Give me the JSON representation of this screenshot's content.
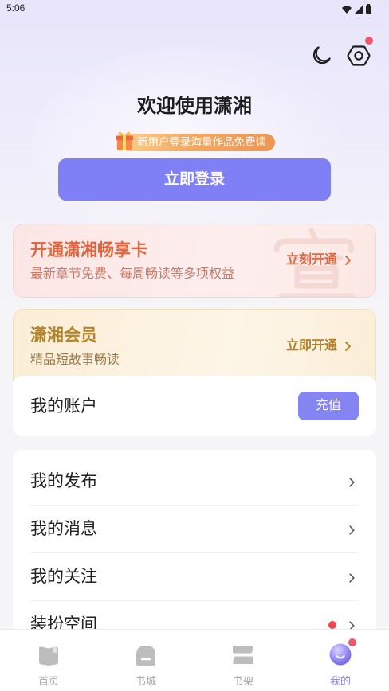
{
  "status_bar": {
    "time": "5:06",
    "icons": [
      "wifi-icon",
      "signal-icon",
      "battery-icon"
    ]
  },
  "header": {
    "night_mode_icon": "moon-icon",
    "settings_icon": "settings-icon",
    "settings_badge": true
  },
  "welcome": {
    "title": "欢迎使用潇湘",
    "promo_icon": "gift-icon",
    "promo_text": "新用户登录海量作品免费读",
    "login_button": "立即登录"
  },
  "vip_card": {
    "title": "开通潇湘畅享卡",
    "subtitle": "最新章节免费、每周畅读等多项权益",
    "action": "立刻开通"
  },
  "member_card": {
    "title": "潇湘会员",
    "subtitle": "精品短故事畅读",
    "action": "立即开通"
  },
  "account_card": {
    "label": "我的账户",
    "recharge_button": "充值"
  },
  "menu": {
    "items": [
      {
        "label": "我的发布",
        "badge": false
      },
      {
        "label": "我的消息",
        "badge": false
      },
      {
        "label": "我的关注",
        "badge": false
      },
      {
        "label": "装扮空间",
        "badge": true
      }
    ]
  },
  "bottom_nav": {
    "items": [
      {
        "label": "首页",
        "icon": "book-icon",
        "active": false,
        "badge": false
      },
      {
        "label": "书城",
        "icon": "store-icon",
        "active": false,
        "badge": false
      },
      {
        "label": "书架",
        "icon": "bookshelf-icon",
        "active": false,
        "badge": false
      },
      {
        "label": "我的",
        "icon": "profile-icon",
        "active": true,
        "badge": true
      }
    ]
  },
  "colors": {
    "accent": "#7f80f5",
    "badge": "#f2586b",
    "vip": "#e2643e",
    "member": "#b3852f",
    "active": "#8c83ee",
    "inactive": "#a9a9a9"
  }
}
